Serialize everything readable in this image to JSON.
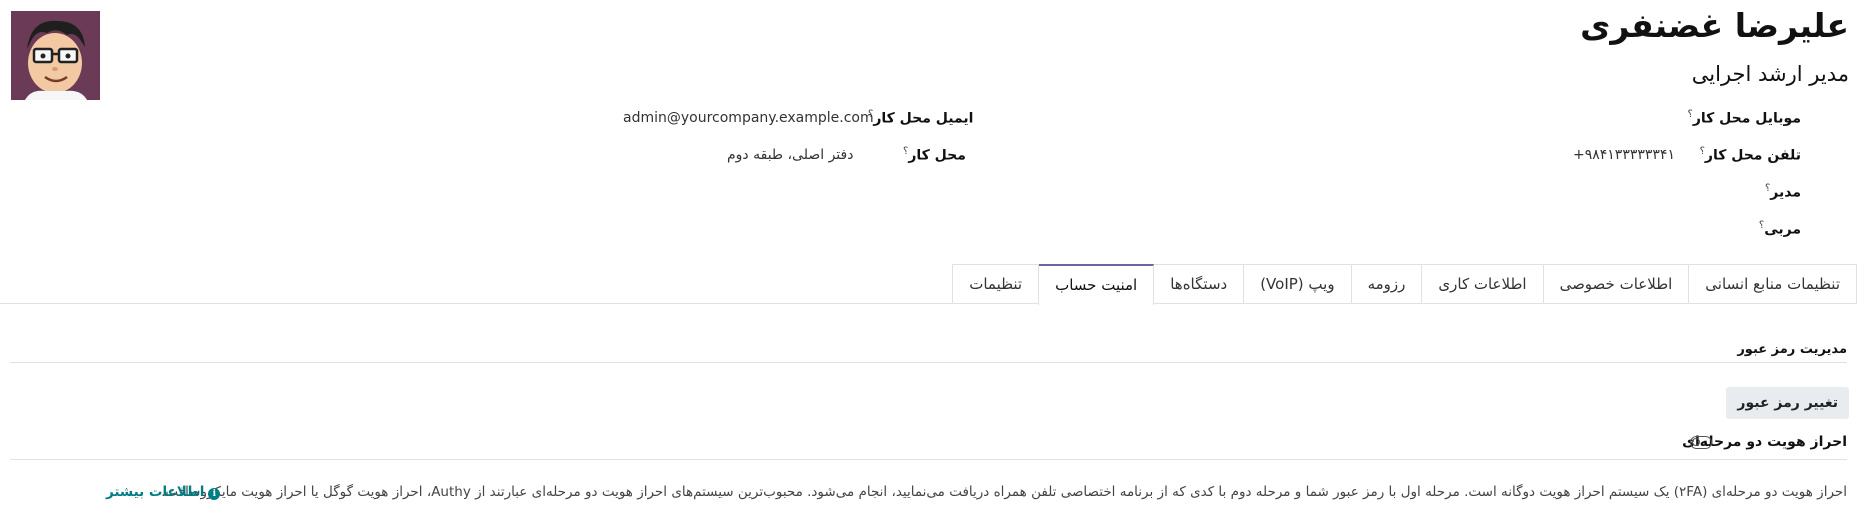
{
  "employee": {
    "name": "علیرضا غضنفری",
    "job_title": "مدیر ارشد اجرایی"
  },
  "fields": {
    "work_mobile": {
      "label": "موبایل محل کار",
      "help": "؟",
      "value": ""
    },
    "work_phone": {
      "label": "تلفن محل کار",
      "help": "؟",
      "value": "+۹۸۴۱۳۳۳۳۳۳۴۱"
    },
    "manager": {
      "label": "مدیر",
      "help": "؟",
      "value": ""
    },
    "coach": {
      "label": "مربی",
      "help": "؟",
      "value": ""
    },
    "work_email": {
      "label": "ایمیل محل کار",
      "help": "؟",
      "value": "admin@yourcompany.example.com"
    },
    "work_location": {
      "label": "محل کار",
      "help": "؟",
      "value": "دفتر اصلی، طبقه دوم"
    }
  },
  "tabs": [
    {
      "label": "تنظیمات",
      "active": false
    },
    {
      "label": "امنیت حساب",
      "active": true
    },
    {
      "label": "دستگاه‌ها",
      "active": false
    },
    {
      "label": "ویپ (VoIP)",
      "active": false
    },
    {
      "label": "رزومه",
      "active": false
    },
    {
      "label": "اطلاعات کاری",
      "active": false
    },
    {
      "label": "اطلاعات خصوصی",
      "active": false
    },
    {
      "label": "تنظیمات منابع انسانی",
      "active": false
    }
  ],
  "security": {
    "section_title": "مدیریت رمز عبور",
    "change_password_button": "تغییر رمز عبور",
    "twofa_label": "احراز هویت دو مرحله‌ای",
    "twofa_enabled": false,
    "description": "احراز هویت دو مرحله‌ای (۲FA) یک سیستم احراز هویت دوگانه است. مرحله اول با رمز عبور شما و مرحله دوم با کدی که از برنامه اختصاصی تلفن همراه دریافت می‌نمایید، انجام می‌شود. محبوب‌ترین سیستم‌های احراز هویت دو مرحله‌ای عبارتند از Authy، احراز هویت گوگل یا احراز هویت مایکروسافت.",
    "learn_more": "اطلاعات بیشتر",
    "info_icon_glyph": "i"
  },
  "colors": {
    "active_tab_accent": "#71639e",
    "link": "#017e84",
    "avatar_bg": "#6b3a56"
  }
}
